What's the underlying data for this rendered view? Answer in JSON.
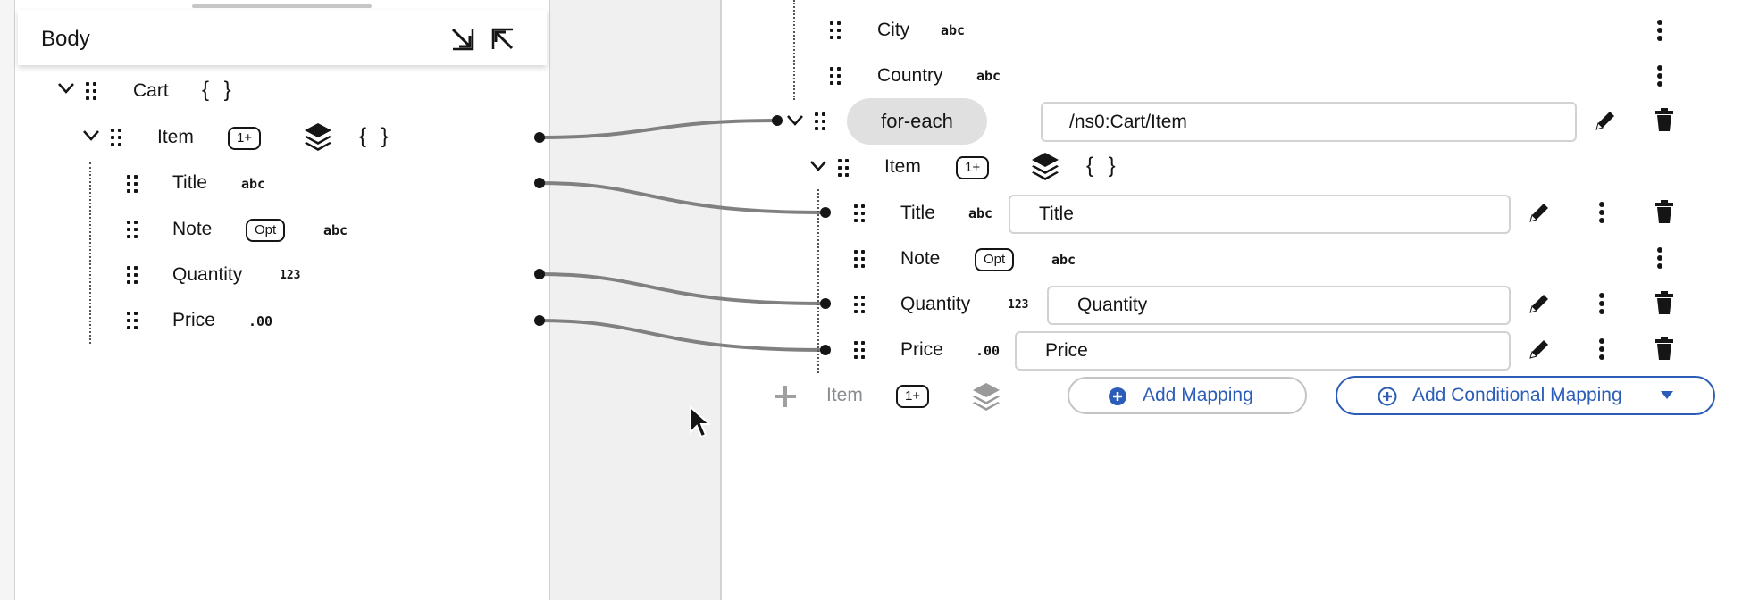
{
  "source_panel": {
    "section_title": "Body",
    "header_icons": [
      "expand-arrow-icon",
      "collapse-arrow-icon"
    ],
    "tree": {
      "cart": {
        "label": "Cart",
        "type_icon": "{ }"
      },
      "item": {
        "label": "Item",
        "badge": "1+",
        "type_icon": "{ }"
      },
      "children": [
        {
          "label": "Title",
          "type": "abc"
        },
        {
          "label": "Note",
          "badge": "Opt",
          "type": "abc"
        },
        {
          "label": "Quantity",
          "type": "123"
        },
        {
          "label": "Price",
          "type": ".00"
        }
      ]
    }
  },
  "target_panel": {
    "partial_rows": [
      {
        "label": "City",
        "type": "abc"
      },
      {
        "label": "Country",
        "type": "abc"
      }
    ],
    "for_each": {
      "label": "for-each",
      "expression": "/ns0:Cart/Item"
    },
    "item": {
      "label": "Item",
      "badge": "1+",
      "type_icon": "{ }"
    },
    "fields": [
      {
        "label": "Title",
        "type": "abc",
        "expression": "Title"
      },
      {
        "label": "Note",
        "badge": "Opt",
        "type": "abc"
      },
      {
        "label": "Quantity",
        "type": "123",
        "expression": "Quantity"
      },
      {
        "label": "Price",
        "type": ".00",
        "expression": "Price"
      }
    ],
    "add_row": {
      "label": "Item",
      "badge": "1+",
      "add_mapping": "Add Mapping",
      "add_conditional_mapping": "Add Conditional Mapping"
    }
  },
  "colors": {
    "connector": "#808080",
    "accent_blue": "#2b5cb8",
    "for_each_bg": "#e0e0e0",
    "field_border": "#d2d2d2"
  }
}
